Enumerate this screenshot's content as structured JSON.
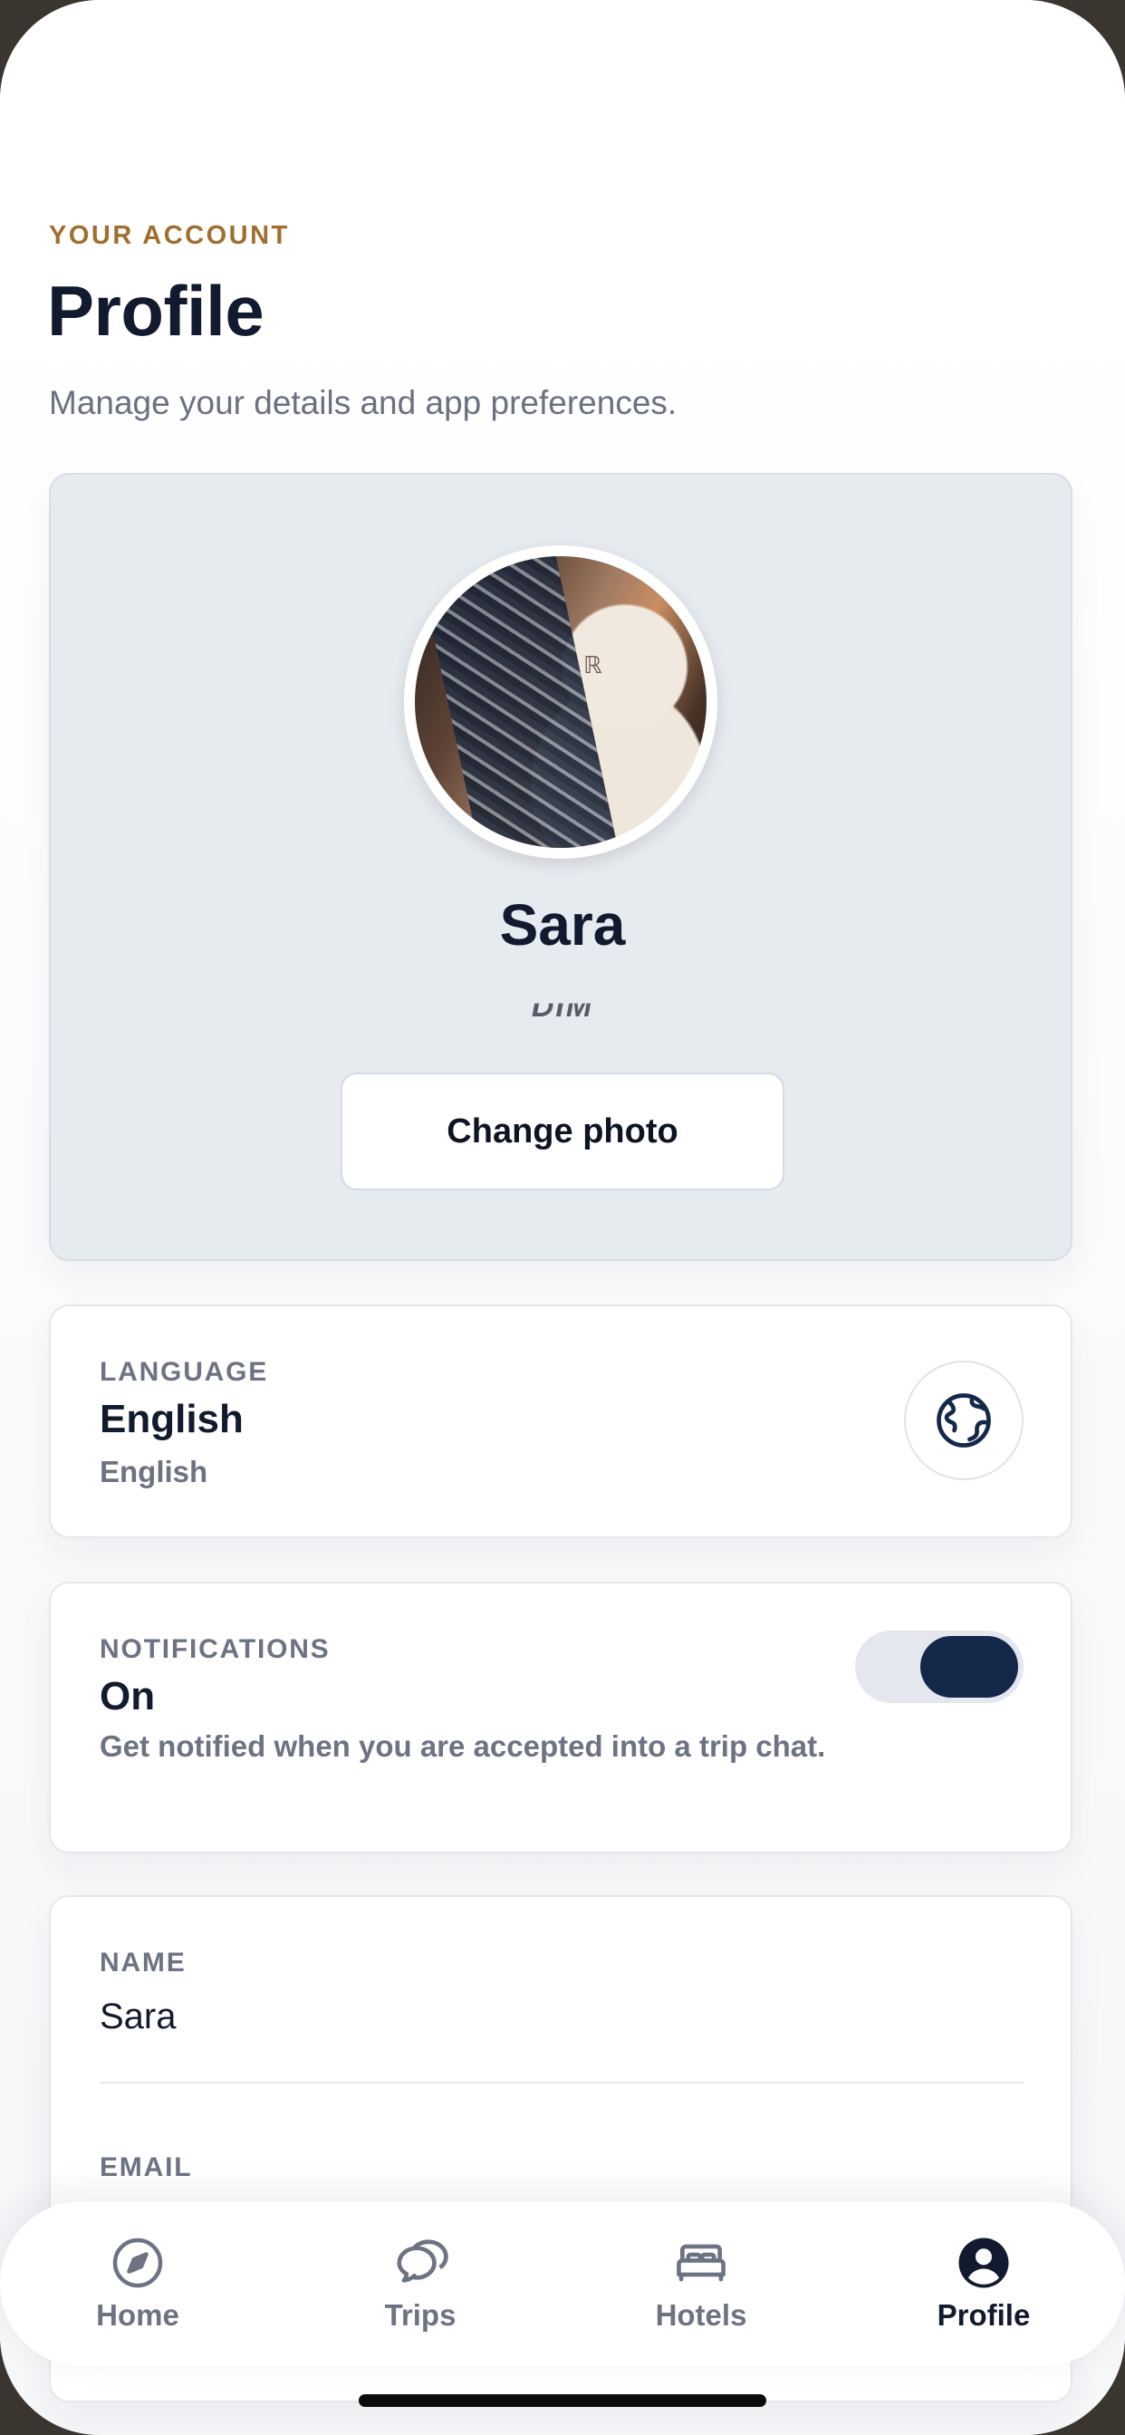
{
  "header": {
    "eyebrow": "YOUR ACCOUNT",
    "title": "Profile",
    "subtitle": "Manage your details and app preferences."
  },
  "profile": {
    "name": "Sara",
    "handle": "DIM",
    "change_photo_label": "Change photo"
  },
  "language": {
    "label": "LANGUAGE",
    "value": "English",
    "subvalue": "English",
    "icon": "globe-icon"
  },
  "notifications": {
    "label": "NOTIFICATIONS",
    "value": "On",
    "description": "Get notified when you are accepted into a trip chat.",
    "enabled": true
  },
  "fields": {
    "name_label": "NAME",
    "name_value": "Sara",
    "email_label": "EMAIL"
  },
  "tabbar": {
    "tabs": [
      {
        "label": "Home",
        "icon": "compass-icon"
      },
      {
        "label": "Trips",
        "icon": "chat-bubbles-icon"
      },
      {
        "label": "Hotels",
        "icon": "bed-icon"
      },
      {
        "label": "Profile",
        "icon": "user-circle-icon"
      }
    ],
    "active": "Profile"
  },
  "colors": {
    "accent_gold": "#a06e2e",
    "navy": "#14284a",
    "muted": "#6c7383"
  }
}
